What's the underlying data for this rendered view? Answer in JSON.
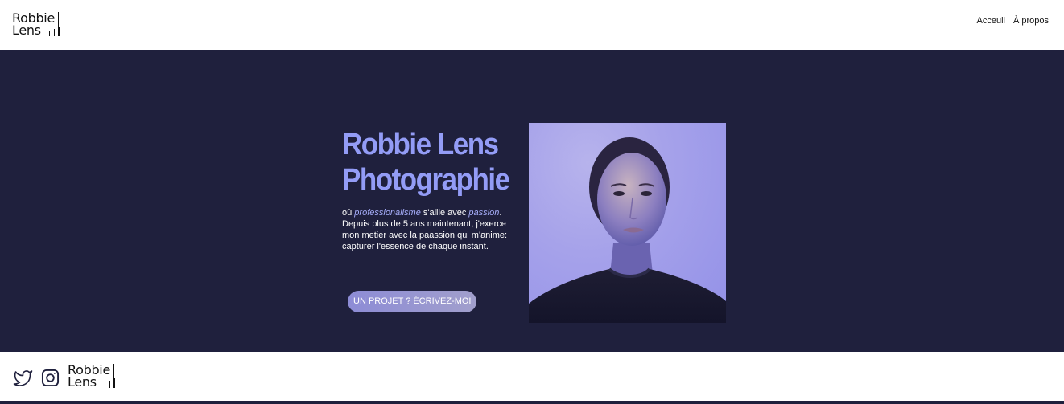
{
  "header": {
    "logo_line1": "Robbie",
    "logo_line2": "Lens",
    "nav": [
      "Acceuil",
      "À propos"
    ]
  },
  "hero": {
    "title_line1": "Robbie Lens",
    "title_line2": "Photographie",
    "desc_prefix": "où ",
    "desc_em1": "professionalisme",
    "desc_mid": " s'allie avec ",
    "desc_em2": "passion",
    "desc_rest": ". Depuis plus de 5 ans maintenant, j'exerce mon metier avec la paassion qui m'anime: capturer l'essence de chaque instant.",
    "cta_label": "UN PROJET ? ÉCRIVEZ-MOI",
    "photo_icon": "portrait-photo"
  },
  "footer": {
    "social_icons": [
      "twitter-icon",
      "instagram-icon"
    ],
    "logo_line1": "Robbie",
    "logo_line2": "Lens"
  },
  "colors": {
    "hero_bg": "#1f203d",
    "accent": "#939cf6",
    "button": "#8f8fcc"
  }
}
